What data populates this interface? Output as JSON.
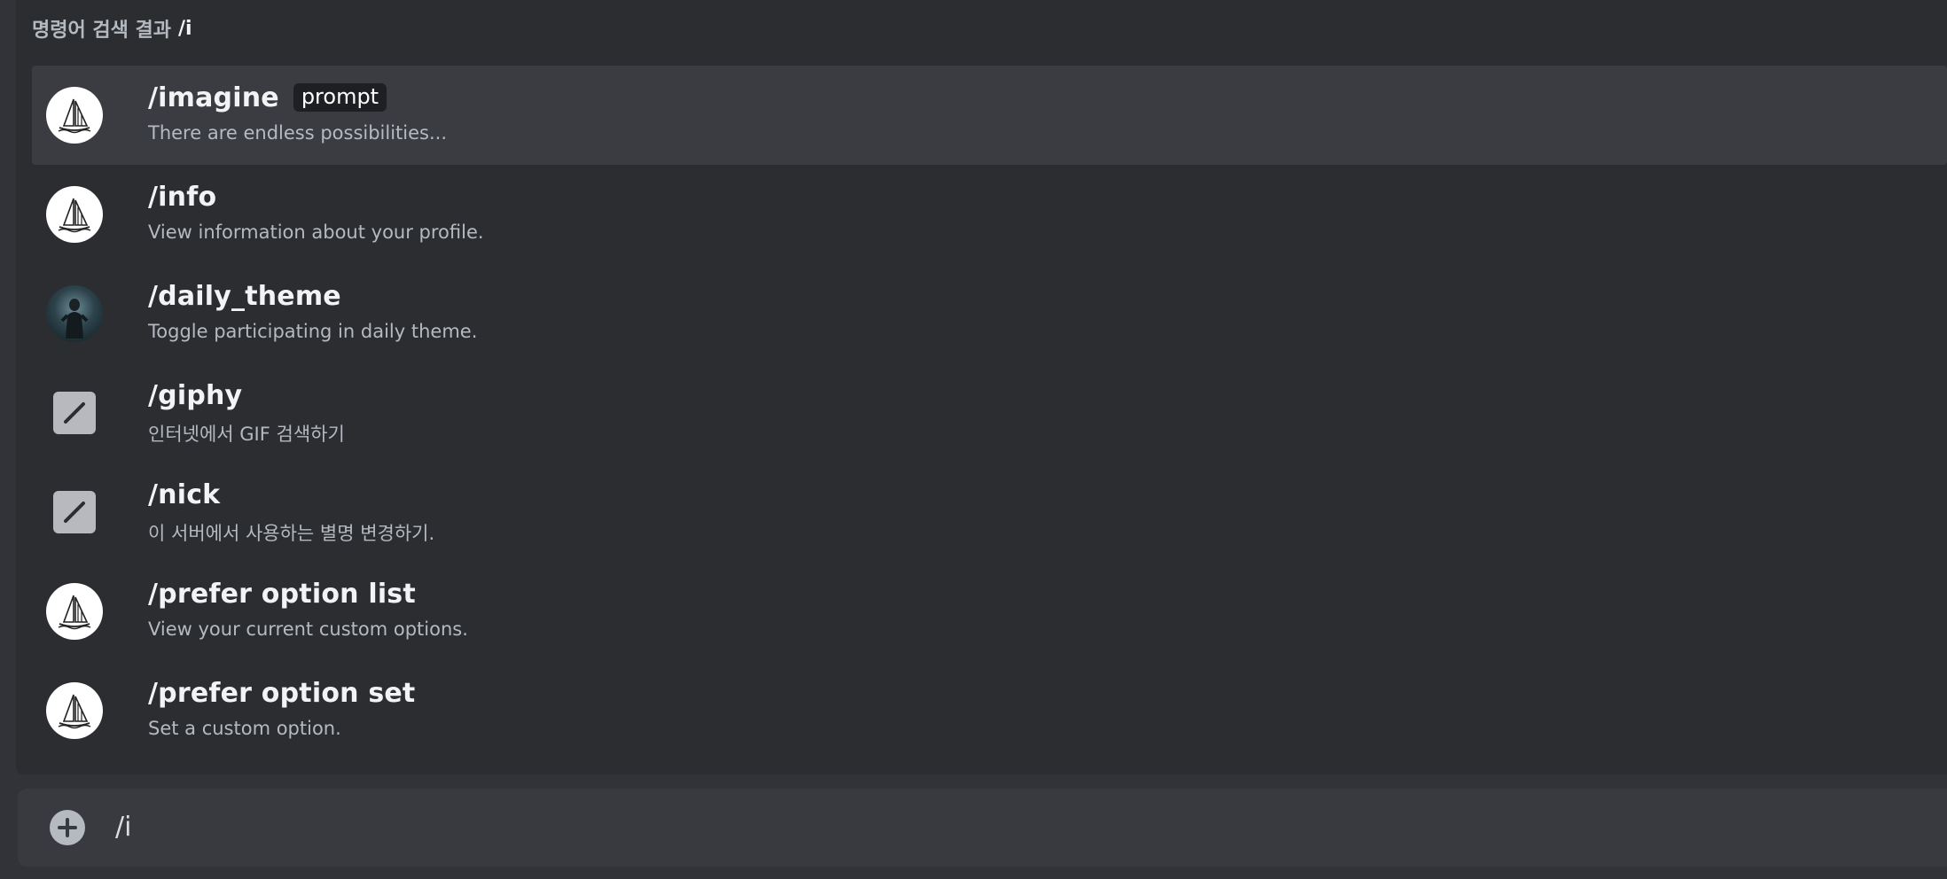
{
  "popup": {
    "header_label": "명령어 검색 결과",
    "query": "/i"
  },
  "commands": [
    {
      "name": "/imagine",
      "option": "prompt",
      "description": "There are endless possibilities...",
      "icon": "midjourney-boat-icon"
    },
    {
      "name": "/info",
      "description": "View information about your profile.",
      "icon": "midjourney-boat-icon"
    },
    {
      "name": "/daily_theme",
      "description": "Toggle participating in daily theme.",
      "icon": "bot-avatar-icon"
    },
    {
      "name": "/giphy",
      "description": "인터넷에서 GIF 검색하기",
      "icon": "slash-command-icon"
    },
    {
      "name": "/nick",
      "description": "이 서버에서 사용하는 별명 변경하기.",
      "icon": "slash-command-icon"
    },
    {
      "name": "/prefer option list",
      "description": "View your current custom options.",
      "icon": "midjourney-boat-icon"
    },
    {
      "name": "/prefer option set",
      "description": "Set a custom option.",
      "icon": "midjourney-boat-icon"
    }
  ],
  "input": {
    "value": "/i",
    "add_icon": "plus-circle-icon"
  },
  "colors": {
    "background": "#313338",
    "popup": "#2b2d31",
    "selected_row": "#3a3c42",
    "input_bg": "#383a40"
  }
}
